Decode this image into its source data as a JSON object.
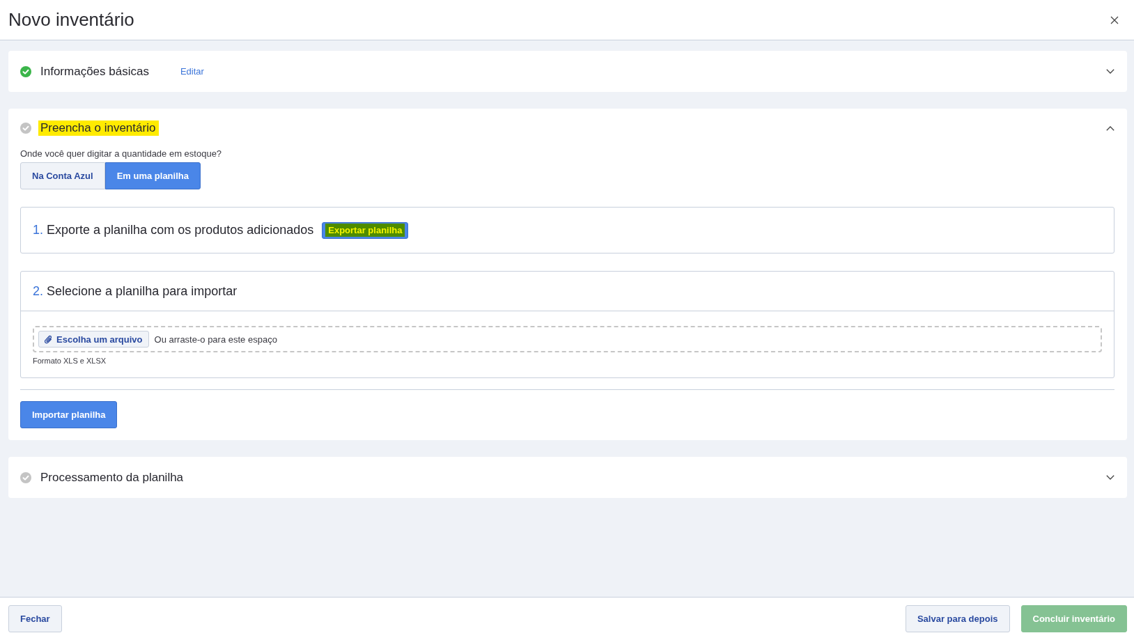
{
  "header": {
    "title": "Novo inventário"
  },
  "sections": [
    {
      "title": "Informações básicas",
      "done": true,
      "expanded": false,
      "highlighted": false,
      "edit_link": "Editar"
    },
    {
      "title": "Preencha o inventário",
      "done": false,
      "expanded": true,
      "highlighted": true,
      "question": "Onde você quer digitar a quantidade em estoque?",
      "options": [
        {
          "label": "Na Conta Azul",
          "selected": false
        },
        {
          "label": "Em uma planilha",
          "selected": true
        }
      ],
      "steps": [
        {
          "kind": "export",
          "number": "1.",
          "title": "Exporte a planilha com os produtos adicionados",
          "button": {
            "label": "Exportar planilha",
            "highlighted": true
          }
        },
        {
          "kind": "upload",
          "number": "2.",
          "title": "Selecione a planilha para importar",
          "upload": {
            "button": "Escolha um arquivo",
            "hint": "Ou arraste-o para este espaço",
            "note": "Formato XLS e XLSX"
          }
        }
      ],
      "action": {
        "label": "Importar planilha"
      }
    },
    {
      "title": "Processamento da planilha",
      "done": false,
      "expanded": false,
      "highlighted": false
    }
  ],
  "footer": {
    "left": [
      {
        "label": "Fechar",
        "kind": "secondary",
        "disabled": false
      }
    ],
    "right": [
      {
        "label": "Salvar para depois",
        "kind": "secondary",
        "disabled": false
      },
      {
        "label": "Concluir inventário",
        "kind": "primary",
        "disabled": true
      }
    ]
  }
}
